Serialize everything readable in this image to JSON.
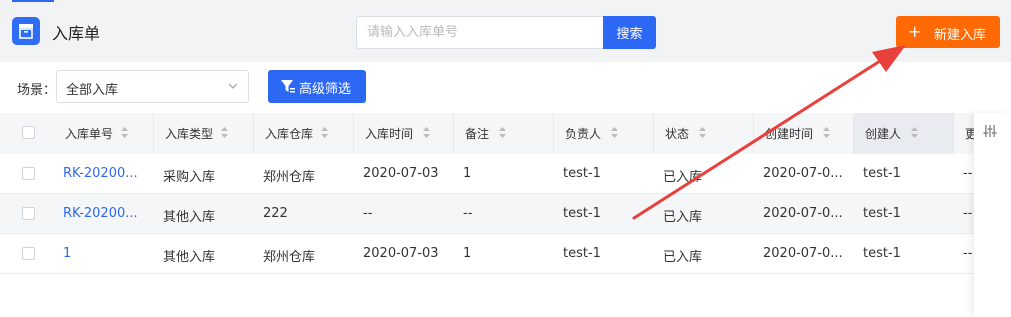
{
  "header": {
    "title": "入库单",
    "search_placeholder": "请输入入库单号",
    "search_label": "搜索",
    "new_button_icon": "+",
    "new_button_label": "新建入库"
  },
  "filters": {
    "scene_label": "场景：",
    "scene_value": "全部入库",
    "advanced_label": "高级筛选"
  },
  "table": {
    "columns": [
      "入库单号",
      "入库类型",
      "入库仓库",
      "入库时间",
      "备注",
      "负责人",
      "状态",
      "创建时间",
      "创建人",
      "更"
    ],
    "rows": [
      [
        "RK-20200...",
        "采购入库",
        "郑州仓库",
        "2020-07-03",
        "1",
        "test-1",
        "已入库",
        "2020-07-0...",
        "test-1",
        "--"
      ],
      [
        "RK-20200...",
        "其他入库",
        "222",
        "--",
        "--",
        "test-1",
        "已入库",
        "2020-07-0...",
        "test-1",
        "--"
      ],
      [
        "1",
        "其他入库",
        "郑州仓库",
        "2020-07-03",
        "1",
        "test-1",
        "已入库",
        "2020-07-0...",
        "test-1",
        "--"
      ]
    ]
  },
  "colors": {
    "primary": "#2d68f5",
    "accent": "#ff6a06",
    "annotation_arrow": "#e8413b"
  }
}
